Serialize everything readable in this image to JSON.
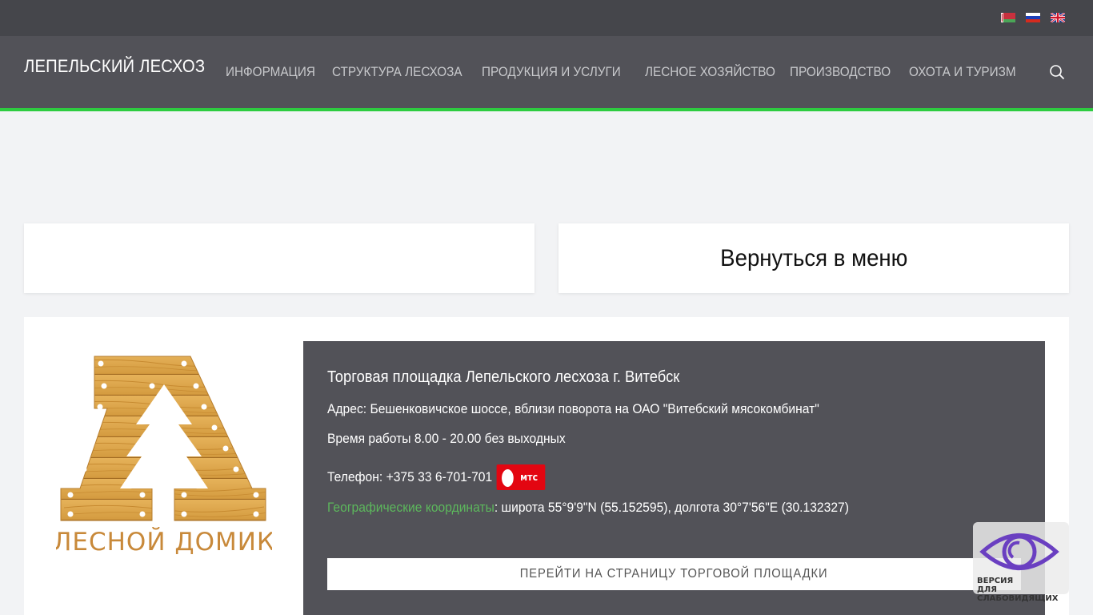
{
  "topbar": {
    "languages": [
      {
        "code": "by",
        "icon": "flag-belarus-icon"
      },
      {
        "code": "ru",
        "icon": "flag-russia-icon"
      },
      {
        "code": "en",
        "icon": "flag-uk-icon"
      }
    ]
  },
  "header": {
    "site_title": "ЛЕПЕЛЬСКИЙ ЛЕСХОЗ",
    "nav": [
      "ИНФОРМАЦИЯ",
      "СТРУКТУРА ЛЕСХОЗА",
      "ПРОДУКЦИЯ И УСЛУГИ",
      "ЛЕСНОЕ ХОЗЯЙСТВО",
      "ПРОИЗВОДСТВО",
      "ОХОТА И ТУРИЗМ"
    ],
    "search_icon": "search-icon",
    "accent_color": "#2ecc40"
  },
  "back_card": {
    "label": "Вернуться в меню"
  },
  "logo": {
    "text": "ЛЕСНОЙ ДОМИК"
  },
  "info": {
    "title": "Торговая площадка Лепельского лесхоза г. Витебск",
    "address": "Адрес: Бешенковичское шоссе, вблизи поворота на ОАО \"Витебский мясокомбинат\"",
    "hours": "Время работы 8.00 - 20.00 без выходных",
    "phone": "Телефон: +375 33 6-701-701",
    "operator_logo": "мтс",
    "coords_link": "Географические координаты",
    "coords_text": ": широта 55°9'9\"N (55.152595), долгота 30°7'56\"E (30.132327)",
    "button_label": "ПЕРЕЙТИ НА СТРАНИЦУ ТОРГОВОЙ ПЛОЩАДКИ"
  },
  "accessibility": {
    "line1": "ВЕРСИЯ",
    "line2": "ДЛЯ СЛАБОВИДЯЩИХ",
    "icon": "eye-icon"
  }
}
